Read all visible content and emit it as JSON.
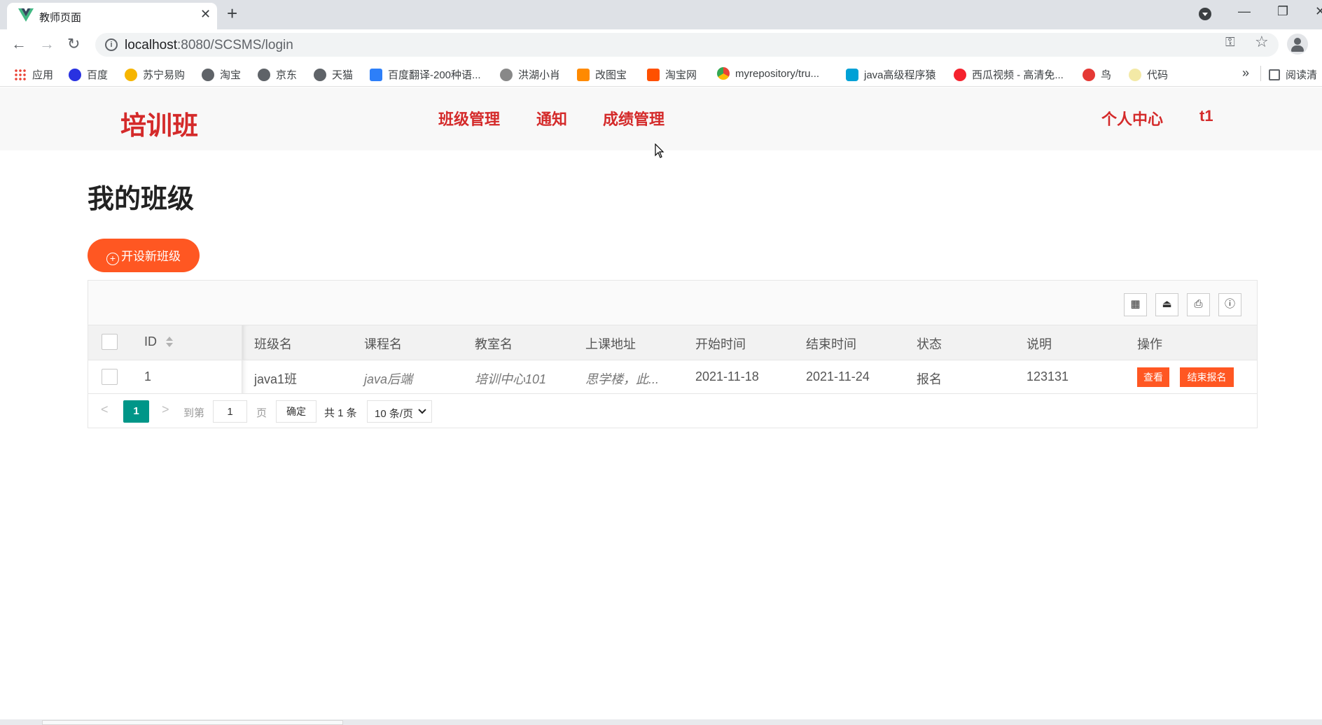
{
  "browser": {
    "tab_title": "教师页面",
    "tab_close": "✕",
    "new_tab": "+",
    "url_host": "localhost",
    "url_path": ":8080/SCSMS/login",
    "window": {
      "minimize": "—",
      "restore": "❐",
      "close": "✕"
    },
    "bookmarks": [
      {
        "label": "应用",
        "icon": "apps-grid-icon"
      },
      {
        "label": "百度",
        "icon": "baidu-paw-icon"
      },
      {
        "label": "苏宁易购",
        "icon": "suning-icon"
      },
      {
        "label": "淘宝",
        "icon": "globe-icon"
      },
      {
        "label": "京东",
        "icon": "globe-icon"
      },
      {
        "label": "天猫",
        "icon": "globe-icon"
      },
      {
        "label": "百度翻译-200种语...",
        "icon": "translate-icon"
      },
      {
        "label": "洪湖小肖",
        "icon": "bird-icon"
      },
      {
        "label": "改图宝",
        "icon": "gaitubao-icon"
      },
      {
        "label": "淘宝网",
        "icon": "taobao-icon"
      },
      {
        "label": "myrepository/tru...",
        "icon": "chrome-icon"
      },
      {
        "label": "java高级程序猿",
        "icon": "bilibili-icon"
      },
      {
        "label": "西瓜视频 - 高清免...",
        "icon": "xigua-icon"
      },
      {
        "label": "鸟",
        "icon": "bird2-icon"
      },
      {
        "label": "代码",
        "icon": "code-icon"
      }
    ],
    "bookmarks_more": "»",
    "reading_list": "阅读清"
  },
  "site": {
    "logo": "培训班",
    "nav": [
      "班级管理",
      "通知",
      "成绩管理"
    ],
    "nav_right": [
      "个人中心",
      "t1"
    ]
  },
  "main": {
    "title": "我的班级",
    "new_class_button": "开设新班级",
    "new_class_plus": "+",
    "toolbar_icons": [
      "columns-icon",
      "export-icon",
      "print-icon",
      "info-icon"
    ],
    "toolbar_glyphs": [
      "▦",
      "⏏",
      "⎙",
      "ⓘ"
    ],
    "table": {
      "headers": [
        "ID",
        "班级名",
        "课程名",
        "教室名",
        "上课地址",
        "开始时间",
        "结束时间",
        "状态",
        "说明",
        "操作"
      ],
      "rows": [
        {
          "id": "1",
          "class_name": "java1班",
          "course_name": "java后端",
          "classroom": "培训中心101",
          "address": "思学楼，此...",
          "start": "2021-11-18",
          "end": "2021-11-24",
          "status": "报名",
          "desc": "123131",
          "actions": [
            "查看",
            "结束报名"
          ]
        }
      ]
    },
    "pager": {
      "prev": "<",
      "current": "1",
      "next": ">",
      "goto_label": "到第",
      "goto_value": "1",
      "page_label": "页",
      "confirm": "确定",
      "total": "共 1 条",
      "page_size": "10 条/页"
    }
  },
  "colors": {
    "accent": "#ff5722",
    "brand_red": "#d42a2a",
    "pager_active": "#009688"
  }
}
